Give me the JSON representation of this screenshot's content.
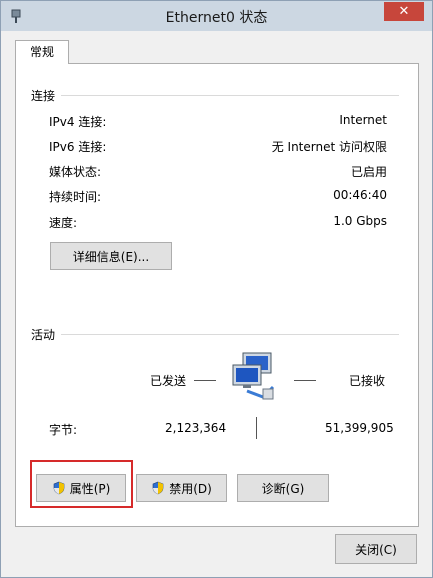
{
  "window": {
    "title": "Ethernet0 状态",
    "close_label": "✕"
  },
  "tabs": [
    {
      "label": "常规"
    }
  ],
  "connection": {
    "section_label": "连接",
    "rows": [
      {
        "label": "IPv4 连接:",
        "value": "Internet"
      },
      {
        "label": "IPv6 连接:",
        "value": "无 Internet 访问权限"
      },
      {
        "label": "媒体状态:",
        "value": "已启用"
      },
      {
        "label": "持续时间:",
        "value": "00:46:40"
      },
      {
        "label": "速度:",
        "value": "1.0 Gbps"
      }
    ],
    "details_button": "详细信息(E)..."
  },
  "activity": {
    "section_label": "活动",
    "sent_label": "已发送",
    "received_label": "已接收",
    "bytes_label": "字节:",
    "bytes_sent": "2,123,364",
    "bytes_received": "51,399,905"
  },
  "buttons": {
    "properties": "属性(P)",
    "disable": "禁用(D)",
    "diagnose": "诊断(G)",
    "close": "关闭(C)"
  },
  "colors": {
    "highlight": "#d62a2a",
    "titlebar": "#ccd7e2",
    "close_button": "#c7463b"
  }
}
